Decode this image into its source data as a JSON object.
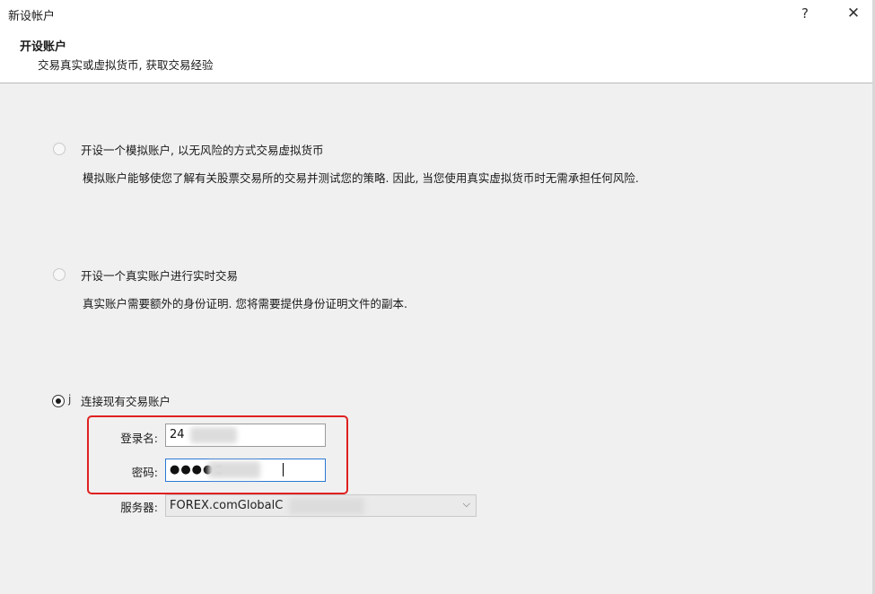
{
  "window": {
    "title": "新设帐户",
    "help_label": "?",
    "close_label": "✕"
  },
  "header": {
    "title": "开设账户",
    "subtitle": "交易真实或虚拟货币, 获取交易经验"
  },
  "options": {
    "demo": {
      "label": "开设一个模拟账户, 以无风险的方式交易虚拟货币",
      "description": "模拟账户能够使您了解有关股票交易所的交易并测试您的策略. 因此, 当您使用真实虚拟货币时无需承担任何风险."
    },
    "real": {
      "label": "开设一个真实账户进行实时交易",
      "description": "真实账户需要额外的身份证明. 您将需要提供身份证明文件的副本."
    },
    "existing": {
      "label": "连接现有交易账户",
      "focus_mark": "j"
    }
  },
  "form": {
    "login_label": "登录名:",
    "login_value": "24",
    "password_label": "密码:",
    "password_value": "●●●●●",
    "server_label": "服务器:",
    "server_value": "FOREX.comGlobalC"
  },
  "icons": {
    "dropdown": "chevron-down-icon"
  },
  "colors": {
    "highlight_box": "#e02020",
    "focus_border": "#2a78d4"
  }
}
